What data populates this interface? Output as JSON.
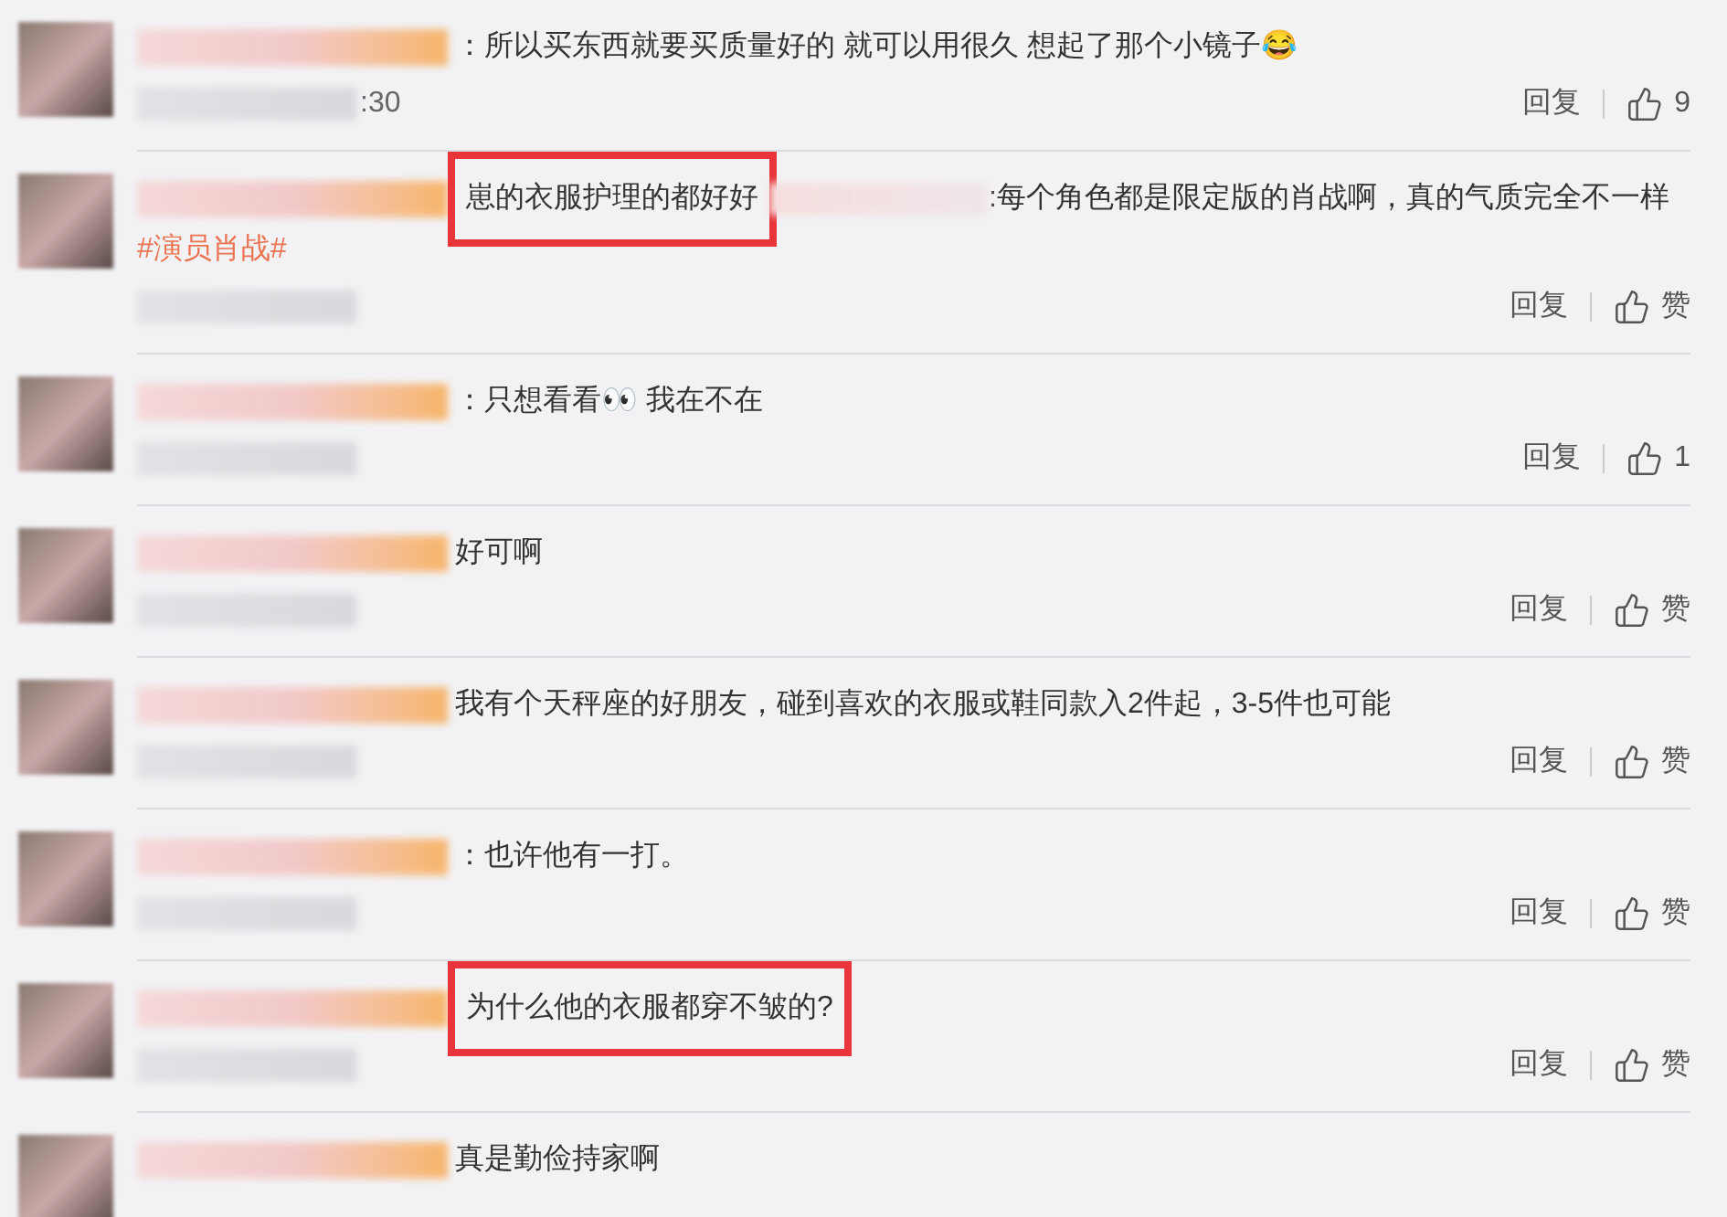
{
  "comments": [
    {
      "parts": [
        {
          "kind": "text",
          "text": "：所以买东西就要买质量好的 就可以用很久 想起了那个小镜子😂",
          "highlighted": false
        }
      ],
      "time": ":30",
      "reply": "回复",
      "likes": "9"
    },
    {
      "parts": [
        {
          "kind": "text",
          "text": "崽的衣服护理的都好好",
          "highlighted": true
        },
        {
          "kind": "blur"
        },
        {
          "kind": "text",
          "text": ":每个角色都是限定版的肖战啊，真的气质完全不一样",
          "highlighted": false
        },
        {
          "kind": "hashtag",
          "text": "#演员肖战#"
        }
      ],
      "reply": "回复",
      "likes": "赞"
    },
    {
      "parts": [
        {
          "kind": "text",
          "text": "：只想看看👀 我在不在",
          "highlighted": false
        }
      ],
      "reply": "回复",
      "likes": "1"
    },
    {
      "parts": [
        {
          "kind": "text",
          "text": "好可啊",
          "highlighted": false
        }
      ],
      "reply": "回复",
      "likes": "赞"
    },
    {
      "parts": [
        {
          "kind": "text",
          "text": "我有个天秤座的好朋友，碰到喜欢的衣服或鞋同款入2件起，3-5件也可能",
          "highlighted": false
        }
      ],
      "reply": "回复",
      "likes": "赞"
    },
    {
      "parts": [
        {
          "kind": "text",
          "text": "：也许他有一打。",
          "highlighted": false
        }
      ],
      "reply": "回复",
      "likes": "赞"
    },
    {
      "parts": [
        {
          "kind": "text",
          "text": "为什么他的衣服都穿不皱的?",
          "highlighted": true
        }
      ],
      "reply": "回复",
      "likes": "赞"
    },
    {
      "parts": [
        {
          "kind": "text",
          "text": "真是勤俭持家啊",
          "highlighted": false
        }
      ]
    }
  ]
}
